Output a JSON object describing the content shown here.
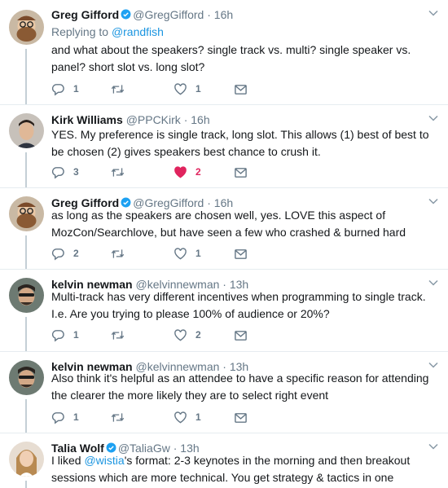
{
  "colors": {
    "link": "#1b95e0",
    "muted": "#657786",
    "like": "#e0245e",
    "thread_line": "#c4cfd6"
  },
  "tweets": [
    {
      "author_name": "Greg Gifford",
      "verified": true,
      "handle": "@GregGifford",
      "separator": "·",
      "time": "16h",
      "replying_prefix": "Replying to ",
      "replying_handle": "@randfish",
      "text": "and what about the speakers? single track vs. multi? single speaker vs. panel? short slot vs. long slot?",
      "reply_count": "1",
      "retweet_count": "",
      "like_count": "1",
      "liked": false
    },
    {
      "author_name": "Kirk Williams",
      "verified": false,
      "handle": "@PPCKirk",
      "separator": "·",
      "time": "16h",
      "text": "YES. My preference is single track, long slot. This allows (1) best of best to be chosen (2) gives speakers best chance to crush it.",
      "reply_count": "3",
      "retweet_count": "",
      "like_count": "2",
      "liked": true
    },
    {
      "author_name": "Greg Gifford",
      "verified": true,
      "handle": "@GregGifford",
      "separator": "·",
      "time": "16h",
      "text": "as long as the speakers are chosen well, yes. LOVE this aspect of MozCon/Searchlove, but have seen a few who crashed & burned hard",
      "reply_count": "2",
      "retweet_count": "",
      "like_count": "1",
      "liked": false
    },
    {
      "author_name": "kelvin newman",
      "verified": false,
      "handle": "@kelvinnewman",
      "separator": "·",
      "time": "13h",
      "text": "Multi-track has very different incentives when programming to single track. I.e. Are you trying to please 100% of audience or 20%?",
      "reply_count": "1",
      "retweet_count": "",
      "like_count": "2",
      "liked": false
    },
    {
      "author_name": "kelvin newman",
      "verified": false,
      "handle": "@kelvinnewman",
      "separator": "·",
      "time": "13h",
      "text": "Also think it's helpful as an attendee to have a specific reason for attending the clearer the more likely they are to select right event",
      "reply_count": "1",
      "retweet_count": "",
      "like_count": "1",
      "liked": false
    },
    {
      "author_name": "Talia Wolf",
      "verified": true,
      "handle": "@TaliaGw",
      "separator": "·",
      "time": "13h",
      "text_before": "I liked ",
      "text_mention": "@wistia",
      "text_after": "'s format: 2-3 keynotes in the morning and then breakout sessions which are more technical. You get strategy & tactics in one"
    }
  ],
  "icons": {
    "reply": "reply-icon",
    "retweet": "retweet-icon",
    "like": "heart-icon",
    "dm": "envelope-icon",
    "verified": "verified-badge-icon",
    "more": "chevron-down-icon"
  }
}
